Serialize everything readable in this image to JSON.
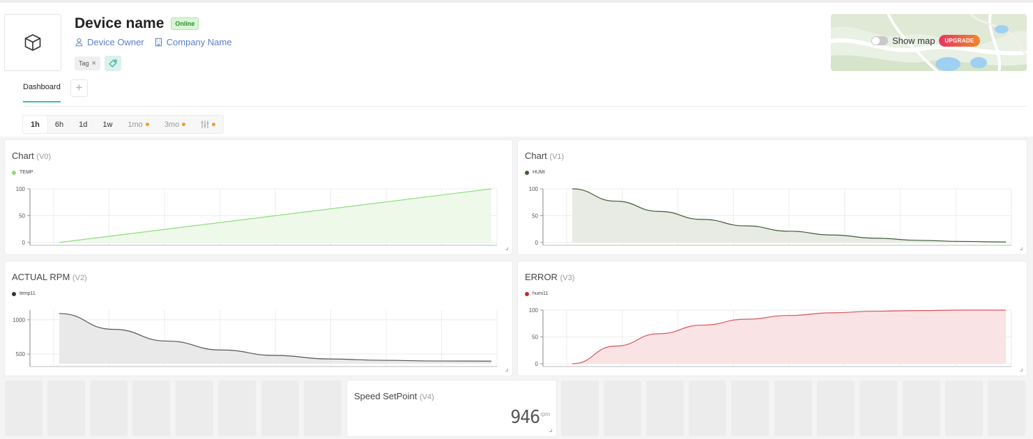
{
  "device": {
    "name": "Device name",
    "status": "Online",
    "owner": "Device Owner",
    "company": "Company Name",
    "tag": "Tag"
  },
  "map": {
    "label": "Show map",
    "upgrade": "UPGRADE"
  },
  "tabs": [
    {
      "label": "Dashboard"
    }
  ],
  "time_range": [
    "1h",
    "6h",
    "1d",
    "1w",
    "1mo",
    "3mo"
  ],
  "widgets": [
    {
      "title": "Chart",
      "pin": "(V0)",
      "legend": "TEMP",
      "color": "#8fdc7c",
      "fill": "#eef9ea"
    },
    {
      "title": "Chart",
      "pin": "(V1)",
      "legend": "HUMI",
      "color": "#3f5a37",
      "fill": "#e8ebe4"
    },
    {
      "title": "ACTUAL RPM",
      "pin": "(V2)",
      "legend": "temp11",
      "color": "#555555",
      "fill": "#e9e9e9"
    },
    {
      "title": "ERROR",
      "pin": "(V3)",
      "legend": "humi11",
      "color": "#d9545c",
      "fill": "#fae3e4"
    }
  ],
  "speed": {
    "title": "Speed SetPoint",
    "pin": "(V4)",
    "value": "946",
    "unit": "rpm"
  },
  "chart_data": [
    {
      "type": "area",
      "series": [
        {
          "name": "TEMP",
          "values": [
            0,
            100
          ]
        }
      ],
      "ylim": [
        0,
        100
      ],
      "yticks": [
        0,
        50,
        100
      ]
    },
    {
      "type": "area",
      "series": [
        {
          "name": "HUMI",
          "values": [
            100,
            77,
            58,
            43,
            31,
            21,
            14,
            8,
            4,
            2,
            1
          ]
        }
      ],
      "ylim": [
        0,
        100
      ],
      "yticks": [
        0,
        50,
        100
      ]
    },
    {
      "type": "area",
      "series": [
        {
          "name": "temp11",
          "values": [
            1090,
            860,
            690,
            560,
            480,
            430,
            410,
            400,
            398
          ]
        }
      ],
      "ylim": [
        360,
        1140
      ],
      "yticks": [
        500,
        1000
      ]
    },
    {
      "type": "area",
      "series": [
        {
          "name": "humi11",
          "values": [
            0,
            33,
            56,
            72,
            83,
            90,
            95,
            98,
            99,
            100,
            100
          ]
        }
      ],
      "ylim": [
        0,
        100
      ],
      "yticks": [
        0,
        50,
        100
      ]
    }
  ]
}
